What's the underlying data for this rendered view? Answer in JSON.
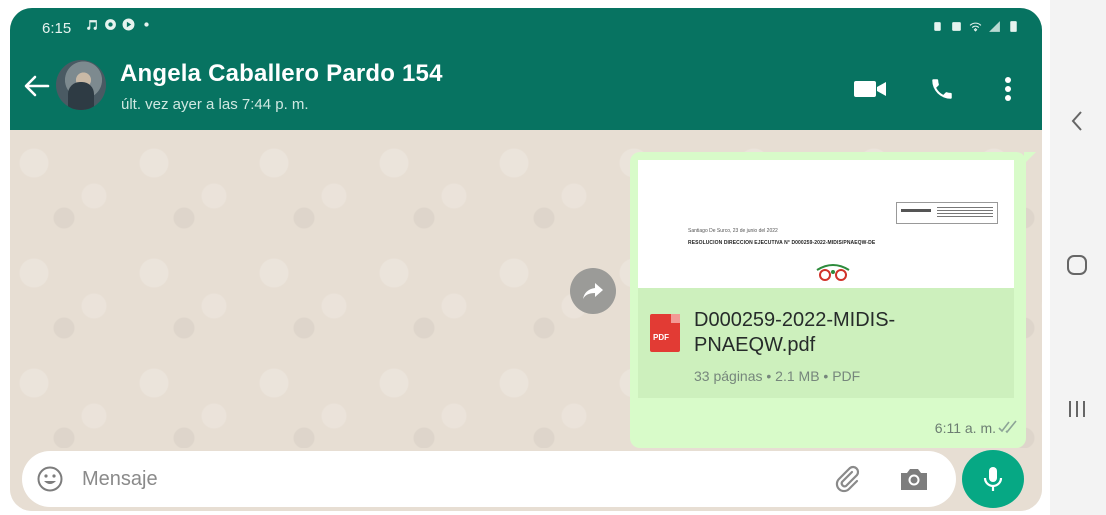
{
  "status_bar": {
    "time": "6:15"
  },
  "header": {
    "contact_name": "Angela Caballero Pardo 154",
    "last_seen": "últ. vez ayer a las 7:44 p. m.",
    "icons": [
      "back-arrow-icon",
      "avatar",
      "video-call-icon",
      "phone-call-icon",
      "more-vert-icon"
    ]
  },
  "message": {
    "preview": {
      "date_line": "Santiago De Surco, 23 de junio del 2022",
      "title_line": "RESOLUCION DIRECCION EJECUTIVA N° D000259-2022-MIDIS/PNAEQW-DE"
    },
    "pdf_badge": "PDF",
    "file_name": "D000259-2022-MIDIS-PNAEQW.pdf",
    "file_meta": "33 páginas • 2.1 MB • PDF",
    "time": "6:11 a. m.",
    "status": "read"
  },
  "composer": {
    "placeholder": "Mensaje",
    "value": ""
  },
  "colors": {
    "header": "#077361",
    "outgoing_bubble": "#d8fbc9",
    "mic_button": "#06a884",
    "pdf_icon": "#e23b34"
  }
}
